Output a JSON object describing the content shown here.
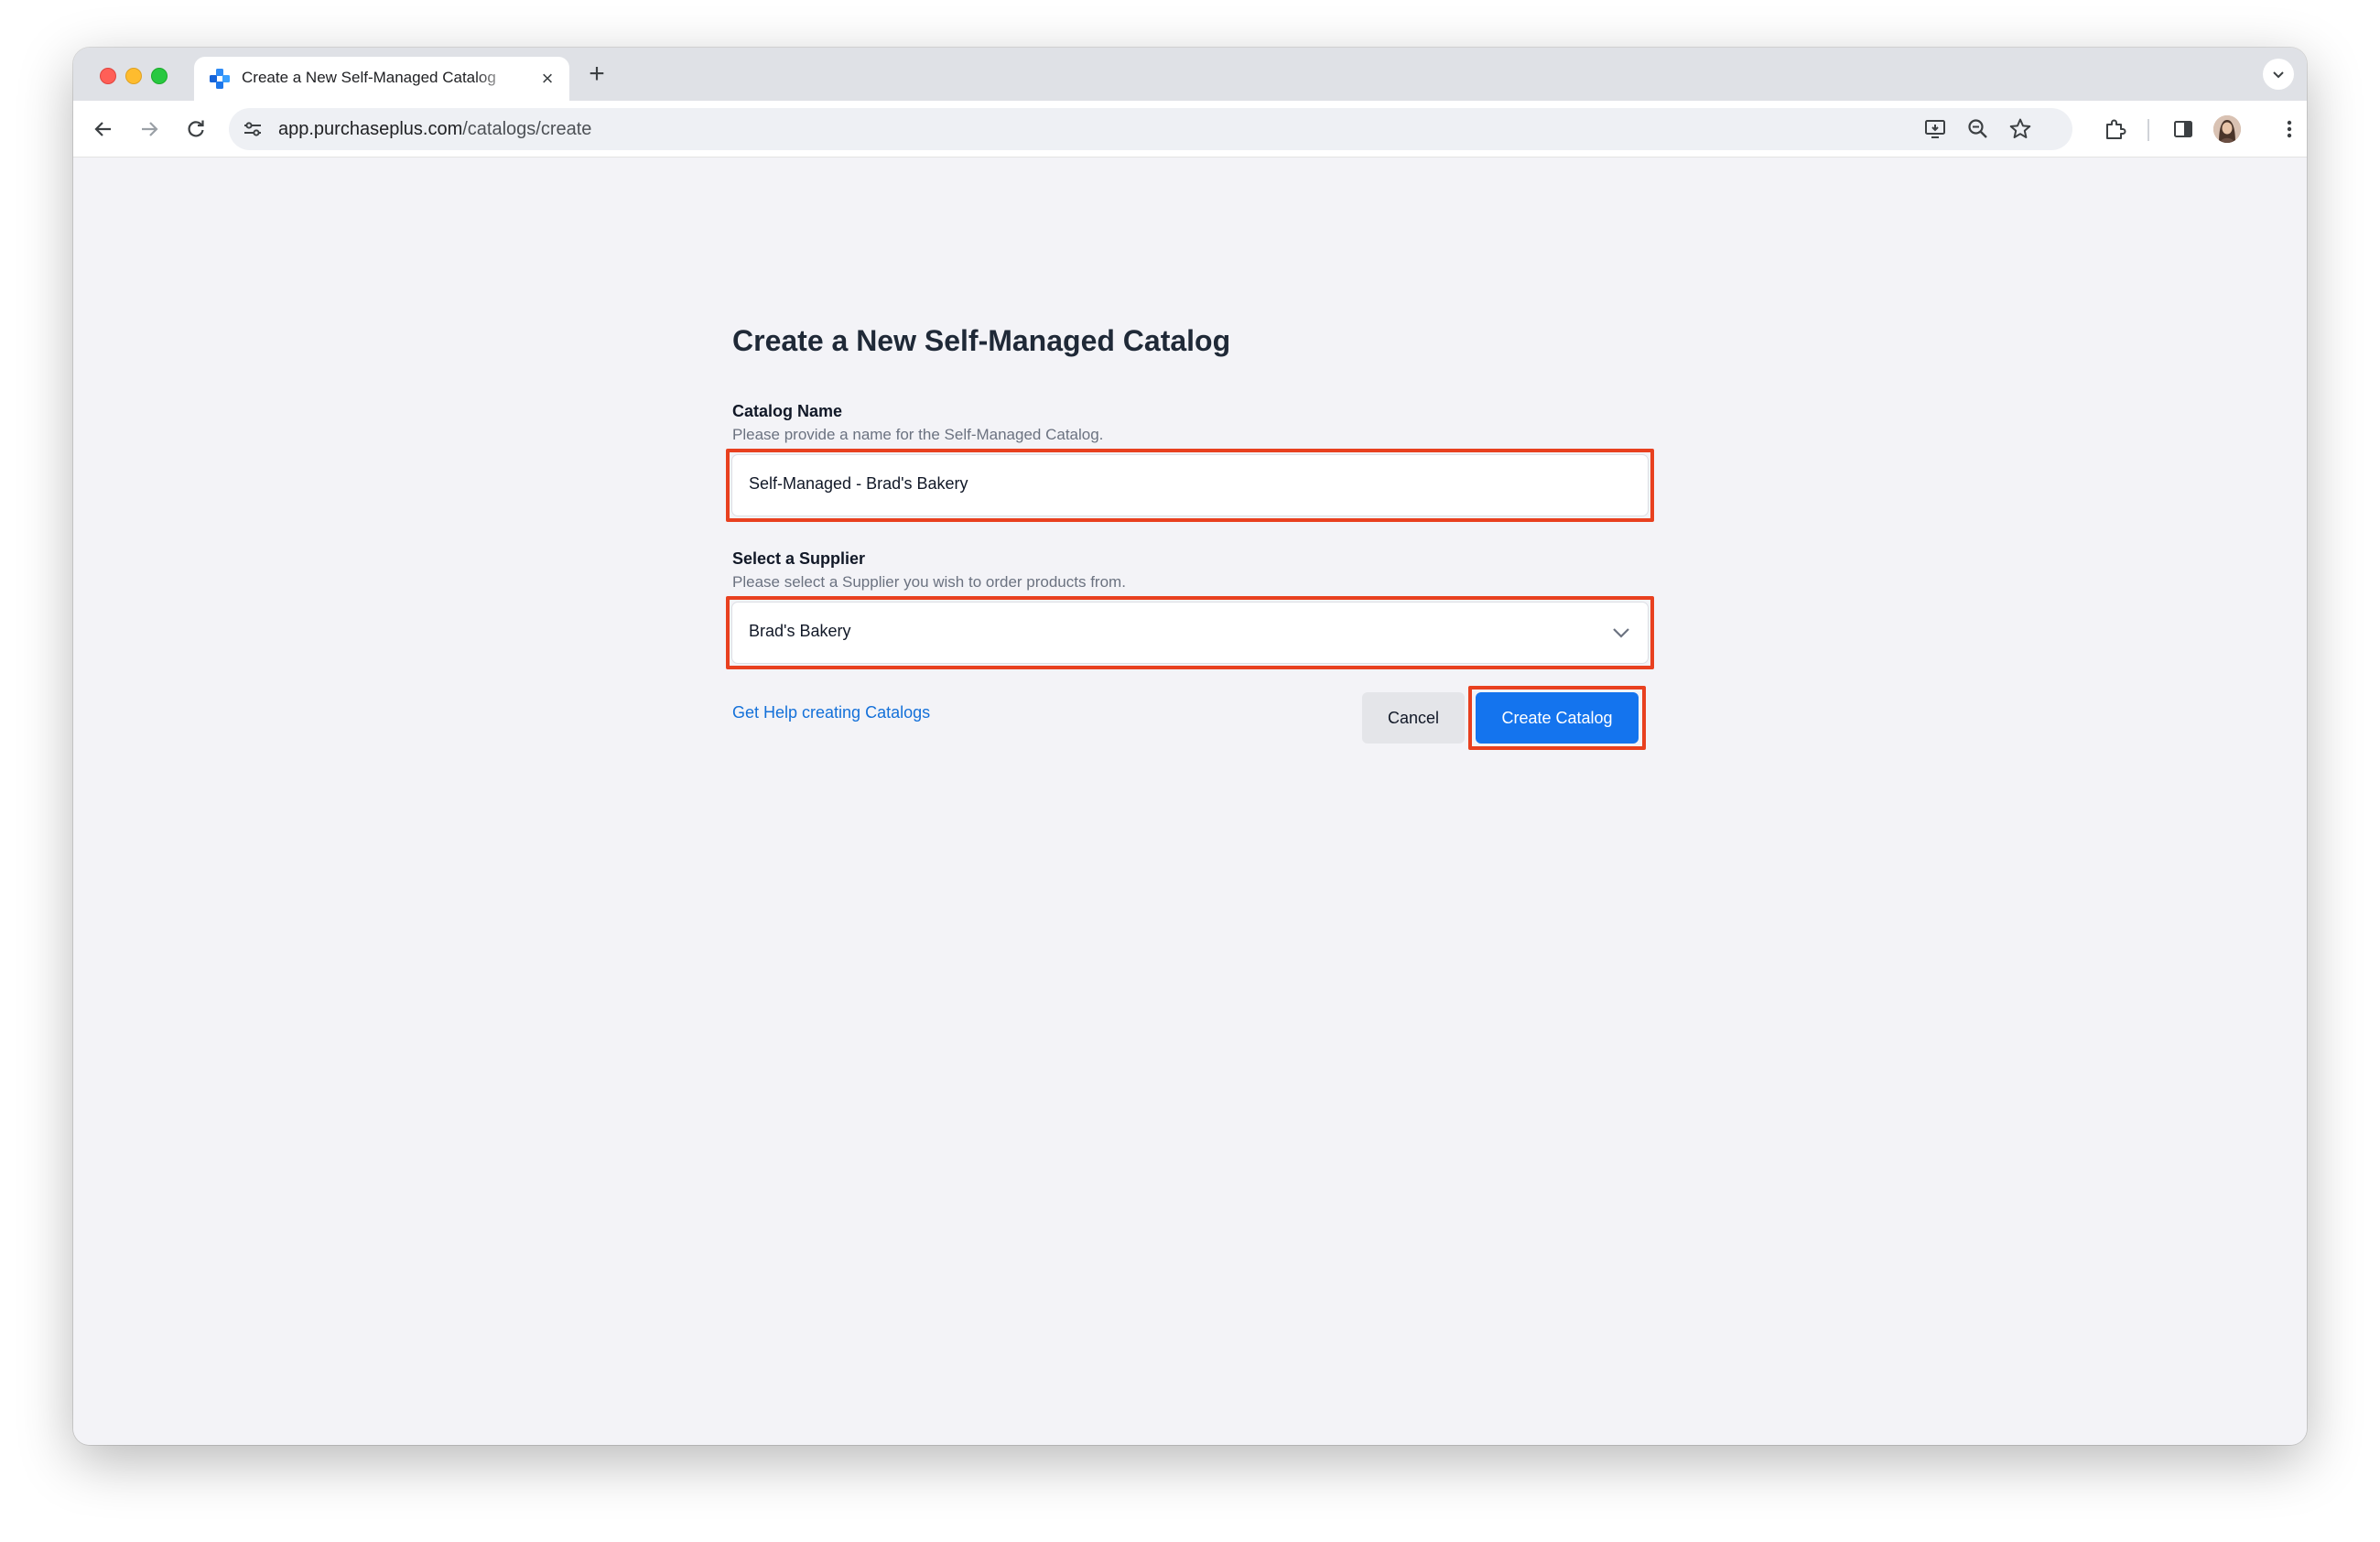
{
  "browser": {
    "tab_title": "Create a New Self-Managed Catalog",
    "tab_close": "×",
    "new_tab": "+",
    "url_host": "app.purchaseplus.com",
    "url_path": "/catalogs/create",
    "icons": [
      "back-arrow-icon",
      "forward-arrow-icon",
      "reload-icon",
      "site-settings-icon",
      "install-app-icon",
      "zoom-icon",
      "bookmark-star-icon",
      "extensions-icon",
      "side-panel-icon",
      "profile-avatar",
      "more-menu-icon",
      "tab-search-icon"
    ]
  },
  "form": {
    "heading": "Create a New Self-Managed Catalog",
    "catalog_name": {
      "label": "Catalog Name",
      "help": "Please provide a name for the Self-Managed Catalog.",
      "value": "Self-Managed - Brad's Bakery"
    },
    "supplier": {
      "label": "Select a Supplier",
      "help": "Please select a Supplier you wish to order products from.",
      "value": "Brad's Bakery"
    },
    "help_link": "Get Help creating Catalogs",
    "cancel_label": "Cancel",
    "submit_label": "Create Catalog"
  },
  "colors": {
    "highlight": "#e8401f",
    "primary": "#1474ee",
    "link": "#1370d9",
    "page_background": "#f3f3f7"
  }
}
